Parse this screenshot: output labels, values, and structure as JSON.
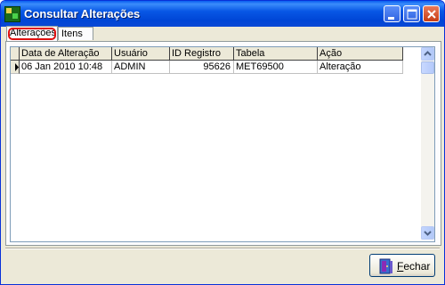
{
  "window": {
    "title": "Consultar Alterações",
    "controls": [
      "minimize",
      "maximize",
      "close"
    ]
  },
  "tabs": [
    {
      "label": "Alterações",
      "active": true
    },
    {
      "label": "Itens",
      "active": false
    }
  ],
  "grid": {
    "columns": [
      "Data de Alteração",
      "Usuário",
      "ID Registro",
      "Tabela",
      "Ação"
    ],
    "rows": [
      {
        "data_alteracao": "06 Jan 2010 10:48",
        "usuario": "ADMIN",
        "id_registro": "95626",
        "tabela": "MET69500",
        "acao": "Alteração"
      }
    ]
  },
  "footer": {
    "close_button": {
      "label": "Fechar",
      "accel": "F",
      "icon": "door-exit-icon"
    }
  },
  "colors": {
    "titlebar": "#0055e5",
    "focus_ring": "#e01010",
    "face": "#ece9d8"
  }
}
